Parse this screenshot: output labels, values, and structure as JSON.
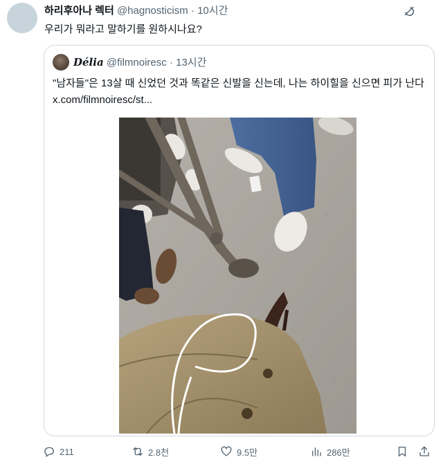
{
  "tweet": {
    "author_name": "하리후아나 렉터",
    "handle": "@hagnosticism",
    "separator": "·",
    "time": "10시간",
    "text": "우리가 뭐라고 말하기를 원하시나요?"
  },
  "quoted_tweet": {
    "author_name": "Délia",
    "handle": "@filmnoiresc",
    "separator": "·",
    "time": "13시간",
    "text": "\"남자들\"은 13살 때 신었던 것과 똑같은 신발을 신는데, 나는 하이힐을 신으면 피가 난다 x.com/filmnoiresc/st..."
  },
  "actions": {
    "replies": "211",
    "reposts": "2.8천",
    "likes": "9.5만",
    "views": "286만"
  },
  "icons": {
    "grok": "grok-icon",
    "reply": "reply-icon",
    "repost": "repost-icon",
    "like": "heart-icon",
    "views": "views-icon",
    "bookmark": "bookmark-icon",
    "share": "share-icon"
  },
  "colors": {
    "text_primary": "#0f1419",
    "text_secondary": "#536471",
    "border": "#cfd9de"
  }
}
